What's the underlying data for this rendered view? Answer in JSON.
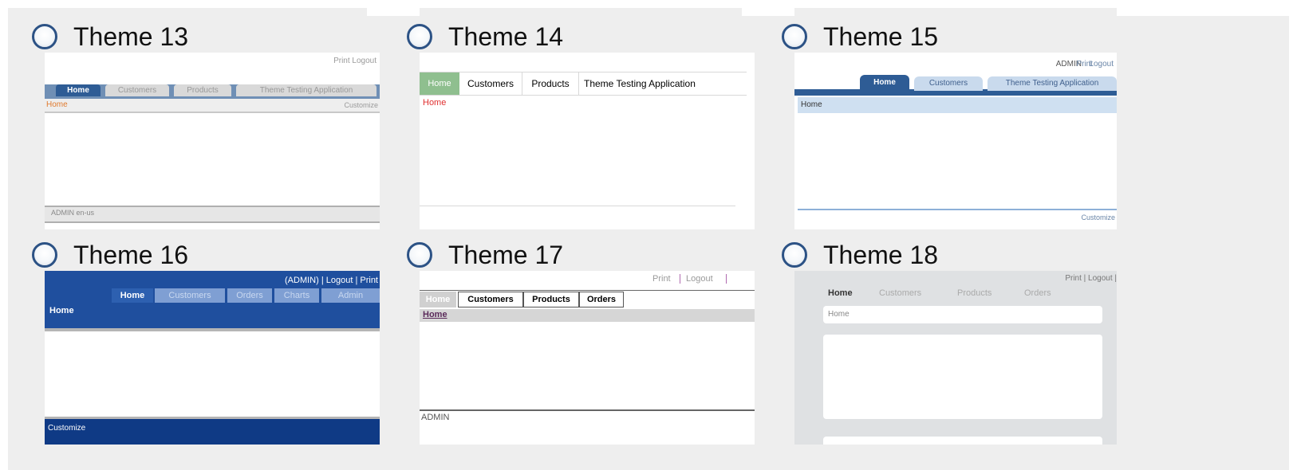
{
  "themes": [
    {
      "label": "Theme 13",
      "preview": {
        "top_links": "Print  Logout",
        "tabs": [
          "Home",
          "Customers",
          "Products",
          "Theme Testing Application"
        ],
        "breadcrumb": "Home",
        "customize": "Customize",
        "footer": "ADMIN  en-us"
      }
    },
    {
      "label": "Theme 14",
      "preview": {
        "tabs": [
          "Home",
          "Customers",
          "Products",
          "Theme Testing Application"
        ],
        "breadcrumb": "Home"
      }
    },
    {
      "label": "Theme 15",
      "preview": {
        "user": "ADMIN",
        "print": "Print",
        "logout": "Logout",
        "tabs": [
          "Home",
          "Customers",
          "Theme Testing Application"
        ],
        "breadcrumb": "Home",
        "customize": "Customize"
      }
    },
    {
      "label": "Theme 16",
      "preview": {
        "top_links": "(ADMIN)  |  Logout  |  Print",
        "tabs": [
          "Home",
          "Customers",
          "Orders",
          "Charts",
          "Admin"
        ],
        "breadcrumb": "Home",
        "customize": "Customize"
      }
    },
    {
      "label": "Theme 17",
      "preview": {
        "print": "Print",
        "logout": "Logout",
        "tabs": [
          "Home",
          "Customers",
          "Products",
          "Orders"
        ],
        "breadcrumb": "Home",
        "footer": "ADMIN"
      }
    },
    {
      "label": "Theme 18",
      "preview": {
        "top_links": "Print | Logout |",
        "tabs": [
          "Home",
          "Customers",
          "Products",
          "Orders"
        ],
        "breadcrumb": "Home"
      }
    }
  ],
  "colors": {
    "background": "#eeeeee",
    "radio_border": "#2c5285",
    "theme16_blue": "#1f4f9e",
    "theme14_green": "#8fbf8f"
  }
}
